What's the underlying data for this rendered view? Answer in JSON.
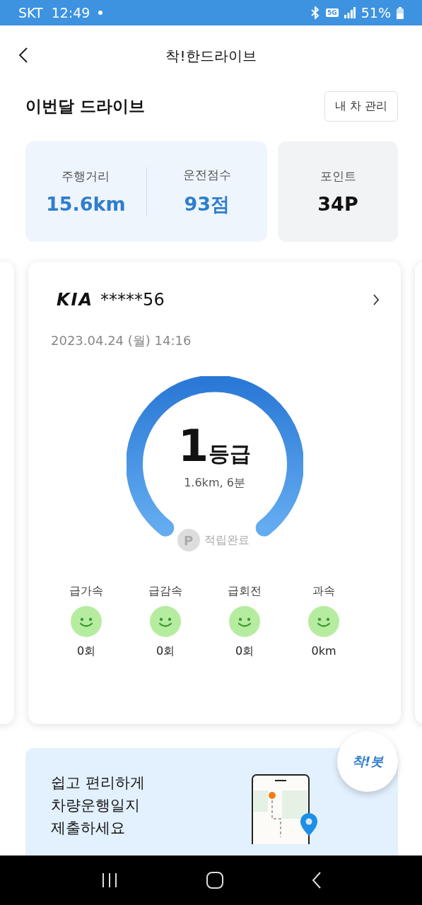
{
  "status_bar": {
    "carrier": "SKT",
    "time": "12:49",
    "network": "5G",
    "battery": "51%"
  },
  "header": {
    "title": "착!한드라이브"
  },
  "section": {
    "title": "이번달 드라이브",
    "button": "내 차 관리"
  },
  "summary": [
    {
      "label": "주행거리",
      "value": "15.6km"
    },
    {
      "label": "운전점수",
      "value": "93점"
    }
  ],
  "points": {
    "label": "포인트",
    "value": "34P"
  },
  "trip": {
    "brand": "KIA",
    "plate": "*****56",
    "date": "2023.04.24 (월) 14:16",
    "grade": "1등급",
    "detail": "1.6km, 6분",
    "point_badge": "P",
    "point_status": "적립완료",
    "events": [
      {
        "label": "급가속",
        "value": "0회"
      },
      {
        "label": "급감속",
        "value": "0회"
      },
      {
        "label": "급회전",
        "value": "0회"
      },
      {
        "label": "과속",
        "value": "0km"
      }
    ]
  },
  "chatbot": "착!봇",
  "banner": {
    "lines": [
      "쉽고 편리하게",
      "차량운행일지",
      "제출하세요"
    ]
  }
}
